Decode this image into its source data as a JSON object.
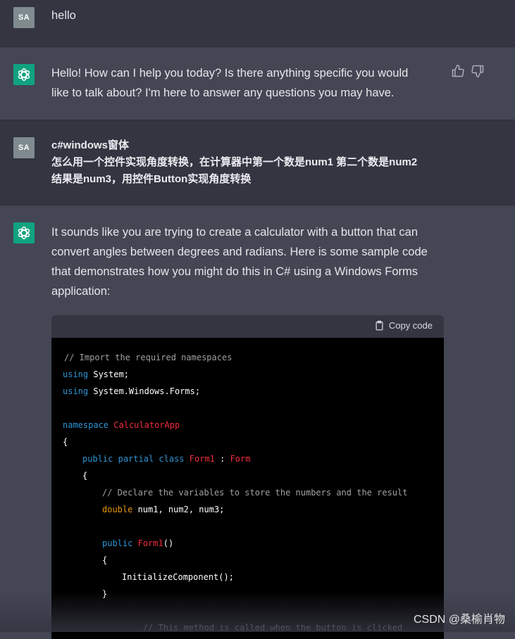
{
  "conversation": {
    "user_avatar_text": "SA",
    "turn1_user": "hello",
    "turn2_bot": [
      "Hello! How can I help you today? Is there anything specific you would",
      "like to talk about? I'm here to answer any questions you may have."
    ],
    "turn3_user": [
      "c#windows窗体",
      "怎么用一个控件实现角度转换，在计算器中第一个数是num1 第二个数是num2",
      "结果是num3，用控件Button实现角度转换"
    ],
    "turn4_bot": [
      "It sounds like you are trying to create a calculator with a button that can",
      "convert angles between degrees and radians. Here is some sample code",
      "that demonstrates how you might do this in C# using a Windows Forms",
      "application:"
    ]
  },
  "code_block": {
    "copy_label": "Copy code",
    "lines": [
      "// Import the required namespaces",
      "using System;",
      "using System.Windows.Forms;",
      "",
      "namespace CalculatorApp",
      "{",
      "    public partial class Form1 : Form",
      "    {",
      "        // Declare the variables to store the numbers and the result",
      "        double num1, num2, num3;",
      "",
      "        public Form1()",
      "        {",
      "            InitializeComponent();",
      "        }",
      "",
      "        // This method is called when the button is clicked"
    ]
  },
  "watermark": "CSDN @桑榆肖物",
  "icons": [
    "openai-logo-icon",
    "thumbs-up-icon",
    "thumbs-down-icon",
    "clipboard-icon"
  ],
  "colors": {
    "user_bg": "#343541",
    "bot_bg": "#444654",
    "bot_avatar": "#10a37f",
    "code_bg": "#000000"
  }
}
